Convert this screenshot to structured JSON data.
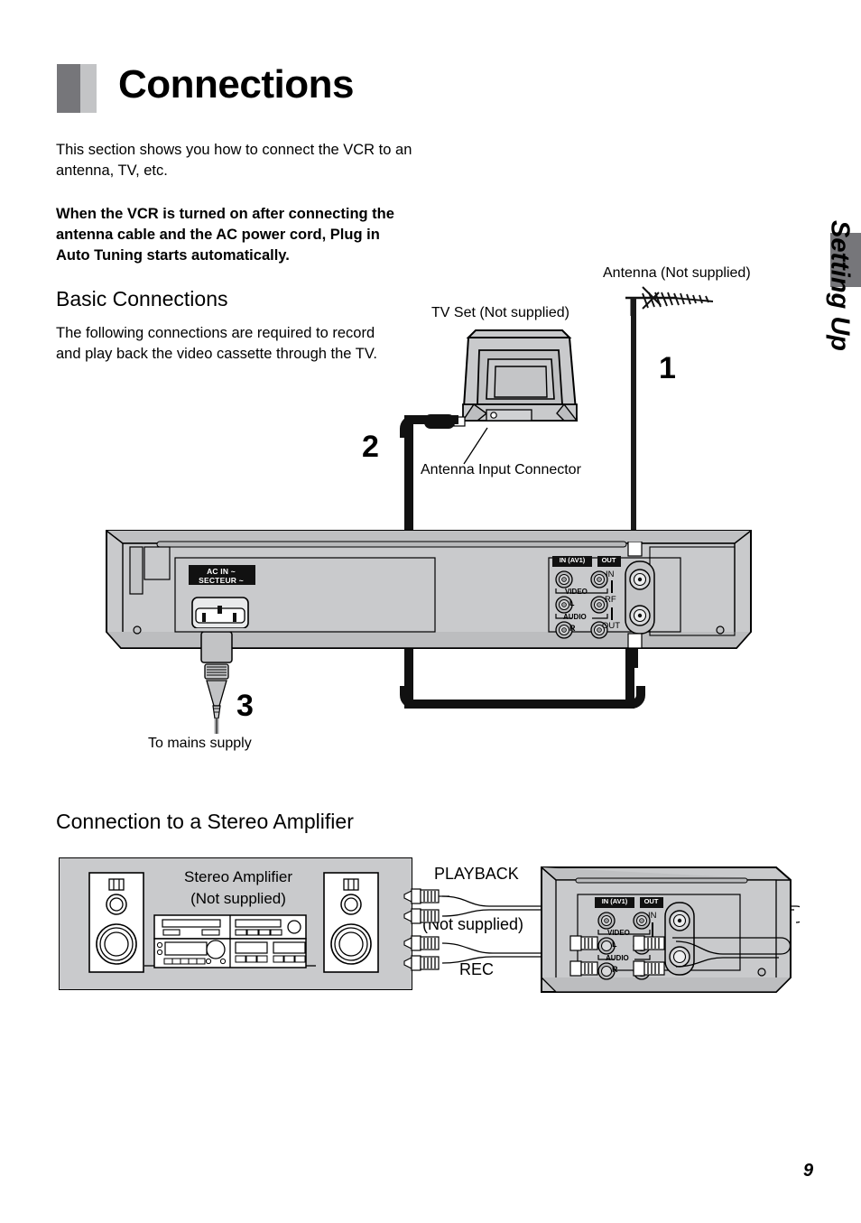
{
  "page": {
    "title": "Connections",
    "number": "9",
    "side_tab": "Setting Up"
  },
  "intro": "This section shows you how to connect the VCR to an antenna, TV, etc.",
  "notice": "When the VCR is turned on after connecting the antenna cable and the AC power cord, Plug in Auto Tuning starts automatically.",
  "basic": {
    "heading": "Basic Connections",
    "body": "The following connections are required to record and play back the video cassette through the TV."
  },
  "stereo": {
    "heading": "Connection to a Stereo Amplifier",
    "amp_label": "Stereo Amplifier\n(Not supplied)",
    "playback": "PLAYBACK",
    "rec": "REC",
    "not_supplied": "(Not supplied)"
  },
  "figure1": {
    "antenna_label": "Antenna (Not supplied)",
    "tv_label": "TV Set (Not supplied)",
    "antenna_input": "Antenna Input Connector",
    "mains": "To mains supply",
    "step1": "1",
    "step2": "2",
    "step3": "3"
  },
  "vcr_panel": {
    "ac_in_line1": "AC IN",
    "ac_in_line2": "SECTEUR",
    "in_av1": "IN (AV1)",
    "out": "OUT",
    "video": "VIDEO",
    "audio": "AUDIO",
    "left": "L",
    "right": "R",
    "rf_in": "IN",
    "rf": "RF",
    "rf_out": "OUT"
  },
  "colors": {
    "tab_gray": "#76767a",
    "block_light": "#c3c4c6",
    "panel_gray": "#c9cacc",
    "cable_black": "#111111"
  }
}
